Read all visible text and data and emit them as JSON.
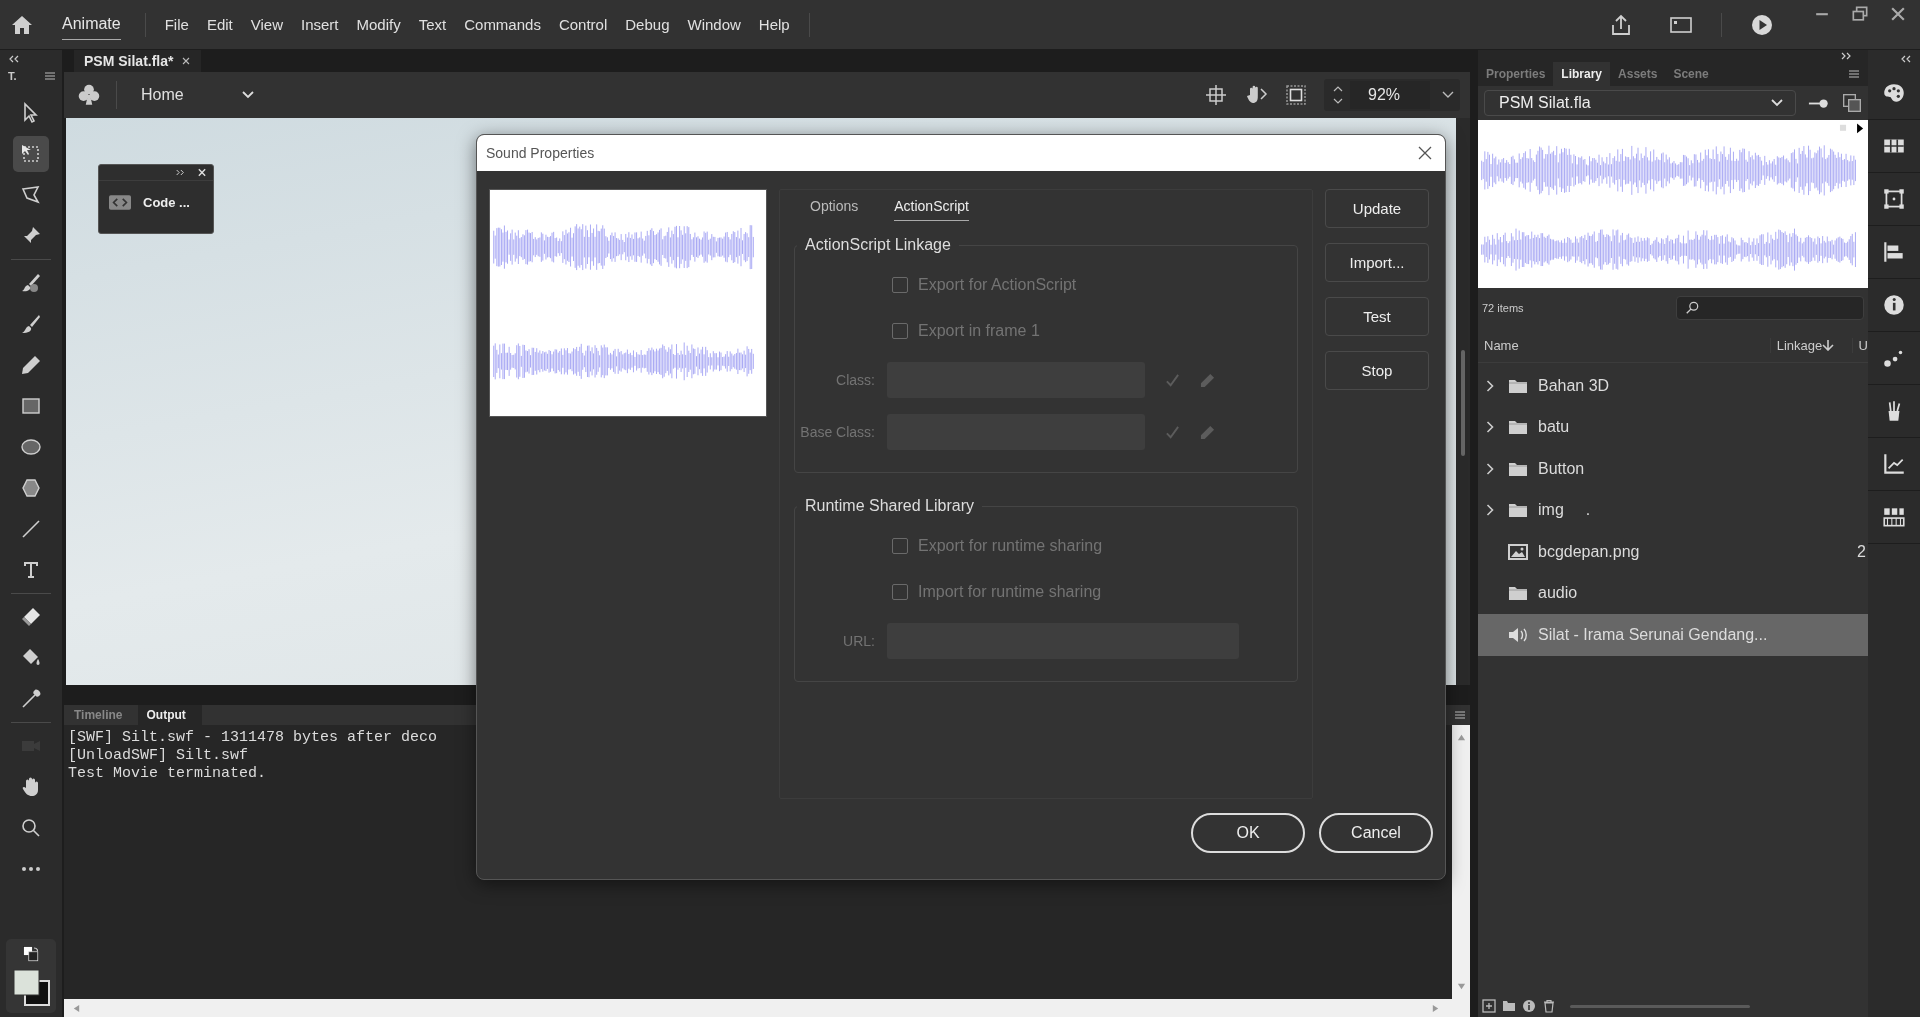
{
  "menu_bar": {
    "app_name": "Animate",
    "items": [
      "File",
      "Edit",
      "View",
      "Insert",
      "Modify",
      "Text",
      "Commands",
      "Control",
      "Debug",
      "Window",
      "Help"
    ]
  },
  "tools_panel": {
    "title": "T.",
    "tools": [
      {
        "selected": false,
        "disabled": false
      },
      {
        "selected": true,
        "disabled": false
      },
      {
        "selected": false,
        "disabled": false
      },
      {
        "selected": false,
        "disabled": false
      },
      {
        "selected": false,
        "disabled": false
      },
      {
        "selected": false,
        "disabled": false
      },
      {
        "selected": false,
        "disabled": false
      },
      {
        "selected": false,
        "disabled": false
      },
      {
        "selected": false,
        "disabled": false
      },
      {
        "selected": false,
        "disabled": false
      },
      {
        "selected": false,
        "disabled": false
      },
      {
        "selected": false,
        "disabled": false
      },
      {
        "selected": false,
        "disabled": false
      },
      {
        "selected": false,
        "disabled": false
      },
      {
        "selected": false,
        "disabled": false
      },
      {
        "selected": false,
        "disabled": true
      },
      {
        "selected": false,
        "disabled": false
      },
      {
        "selected": false,
        "disabled": false
      }
    ]
  },
  "document_tabs": [
    {
      "label": "PSM Silat.fla*",
      "selected": true
    }
  ],
  "edit_bar": {
    "scene": "Home",
    "zoom": "92%"
  },
  "code_snippets_panel": {
    "label": "Code ..."
  },
  "bottom_panel": {
    "tabs": [
      {
        "label": "Timeline",
        "selected": false
      },
      {
        "label": "Output",
        "selected": true
      }
    ],
    "output_lines": [
      "[SWF] Silt.swf - 1311478 bytes after deco",
      "[UnloadSWF] Silt.swf",
      "Test Movie terminated."
    ]
  },
  "right_panel": {
    "tabs": [
      {
        "label": "Properties",
        "selected": false
      },
      {
        "label": "Library",
        "selected": true
      },
      {
        "label": "Assets",
        "selected": false
      },
      {
        "label": "Scene",
        "selected": false
      }
    ],
    "library_name": "PSM Silat.fla",
    "item_count": "72 items",
    "columns": [
      "Name",
      "Linkage",
      "U"
    ],
    "items": [
      {
        "name": "Bahan 3D",
        "kind": "folder",
        "expandable": true,
        "selected": false
      },
      {
        "name": "batu",
        "kind": "folder",
        "expandable": true,
        "selected": false
      },
      {
        "name": "Button",
        "kind": "folder",
        "expandable": true,
        "selected": false
      },
      {
        "name": "img",
        "extra": ".",
        "kind": "folder",
        "expandable": true,
        "selected": false
      },
      {
        "name": "bcgdepan.png",
        "column_3": "2",
        "kind": "image",
        "expandable": false,
        "selected": false
      },
      {
        "name": "audio",
        "kind": "folder",
        "expandable": false,
        "selected": false
      },
      {
        "name": "Silat - Irama Serunai Gendang...",
        "kind": "sound",
        "expandable": false,
        "selected": true
      }
    ]
  },
  "dialog": {
    "title": "Sound Properties",
    "tabs": [
      {
        "label": "Options",
        "selected": false
      },
      {
        "label": "ActionScript",
        "selected": true
      }
    ],
    "groups": [
      {
        "title": "ActionScript Linkage",
        "checkboxes": [
          {
            "label": "Export for ActionScript",
            "checked": false,
            "disabled": true
          },
          {
            "label": "Export in frame 1",
            "checked": false,
            "disabled": true
          }
        ],
        "fields": [
          {
            "label": "Class:",
            "disabled": true,
            "has_actions": true
          },
          {
            "label": "Base Class:",
            "disabled": true,
            "has_actions": true
          }
        ]
      },
      {
        "title": "Runtime Shared Library",
        "checkboxes": [
          {
            "label": "Export for runtime sharing",
            "checked": false,
            "disabled": true
          },
          {
            "label": "Import for runtime sharing",
            "checked": false,
            "disabled": true
          }
        ],
        "fields": [
          {
            "label": "URL:",
            "disabled": true,
            "has_actions": false
          }
        ]
      }
    ],
    "side_buttons": [
      "Update",
      "Import...",
      "Test",
      "Stop"
    ],
    "buttons": [
      "OK",
      "Cancel"
    ]
  }
}
